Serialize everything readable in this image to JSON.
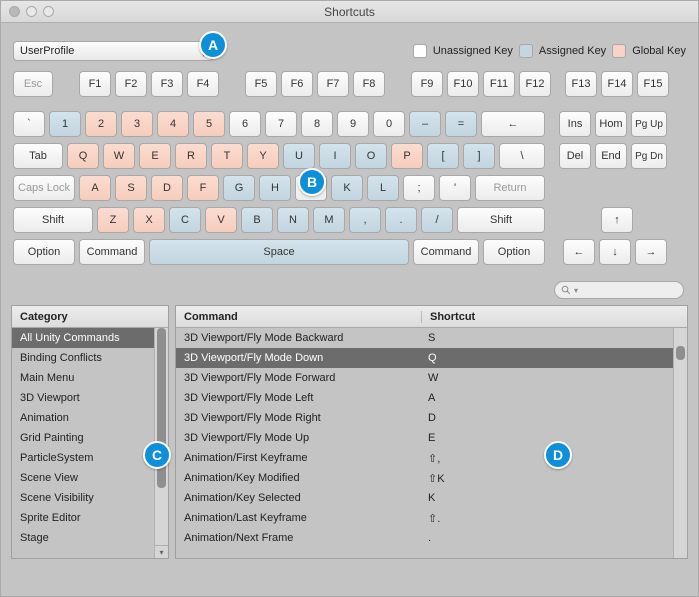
{
  "window": {
    "title": "Shortcuts"
  },
  "profile": {
    "value": "UserProfile"
  },
  "legend": {
    "unassigned": "Unassigned Key",
    "assigned": "Assigned Key",
    "global": "Global Key"
  },
  "badges": {
    "a": "A",
    "b": "B",
    "c": "C",
    "d": "D"
  },
  "keys": {
    "esc": "Esc",
    "f1": "F1",
    "f2": "F2",
    "f3": "F3",
    "f4": "F4",
    "f5": "F5",
    "f6": "F6",
    "f7": "F7",
    "f8": "F8",
    "f9": "F9",
    "f10": "F10",
    "f11": "F11",
    "f12": "F12",
    "f13": "F13",
    "f14": "F14",
    "f15": "F15",
    "tick": "`",
    "n1": "1",
    "n2": "2",
    "n3": "3",
    "n4": "4",
    "n5": "5",
    "n6": "6",
    "n7": "7",
    "n8": "8",
    "n9": "9",
    "n0": "0",
    "minus": "–",
    "equals": "=",
    "back": "←",
    "ins": "Ins",
    "home": "Hom",
    "pgup": "Pg Up",
    "tab": "Tab",
    "q": "Q",
    "w": "W",
    "e": "E",
    "r": "R",
    "t": "T",
    "y": "Y",
    "u": "U",
    "i": "I",
    "o": "O",
    "p": "P",
    "lbr": "[",
    "rbr": "]",
    "bslash": "\\",
    "del": "Del",
    "end": "End",
    "pgdn": "Pg Dn",
    "caps": "Caps Lock",
    "a": "A",
    "s": "S",
    "d": "D",
    "f": "F",
    "g": "G",
    "h": "H",
    "j": "J",
    "k": "K",
    "l": "L",
    "semi": ";",
    "apos": "'",
    "return": "Return",
    "lshift": "Shift",
    "z": "Z",
    "x": "X",
    "c": "C",
    "v": "V",
    "b": "B",
    "n": "N",
    "m": "M",
    "comma": ",",
    "period": ".",
    "slash": "/",
    "rshift": "Shift",
    "up": "↑",
    "lopt": "Option",
    "lcmd": "Command",
    "space": "Space",
    "rcmd": "Command",
    "ropt": "Option",
    "left": "←",
    "down": "↓",
    "right": "→"
  },
  "headers": {
    "category": "Category",
    "command": "Command",
    "shortcut": "Shortcut"
  },
  "categories": [
    "All Unity Commands",
    "Binding Conflicts",
    "Main Menu",
    "3D Viewport",
    "Animation",
    "Grid Painting",
    "ParticleSystem",
    "Scene View",
    "Scene Visibility",
    "Sprite Editor",
    "Stage"
  ],
  "commands": [
    {
      "cmd": "3D Viewport/Fly Mode Backward",
      "sc": "S"
    },
    {
      "cmd": "3D Viewport/Fly Mode Down",
      "sc": "Q"
    },
    {
      "cmd": "3D Viewport/Fly Mode Forward",
      "sc": "W"
    },
    {
      "cmd": "3D Viewport/Fly Mode Left",
      "sc": "A"
    },
    {
      "cmd": "3D Viewport/Fly Mode Right",
      "sc": "D"
    },
    {
      "cmd": "3D Viewport/Fly Mode Up",
      "sc": "E"
    },
    {
      "cmd": "Animation/First Keyframe",
      "sc": "⇧,"
    },
    {
      "cmd": "Animation/Key Modified",
      "sc": "⇧K"
    },
    {
      "cmd": "Animation/Key Selected",
      "sc": "K"
    },
    {
      "cmd": "Animation/Last Keyframe",
      "sc": "⇧."
    },
    {
      "cmd": "Animation/Next Frame",
      "sc": "."
    }
  ],
  "selected_category_index": 0,
  "selected_command_index": 1
}
